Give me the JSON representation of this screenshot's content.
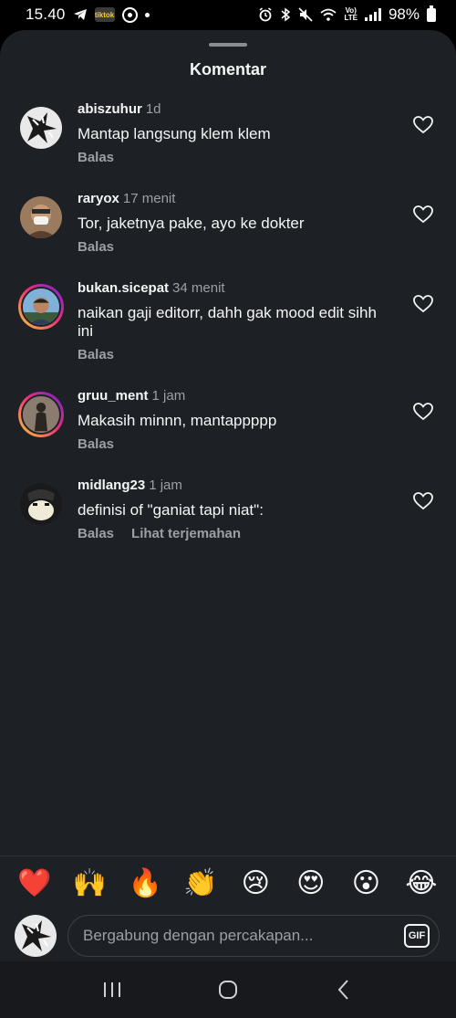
{
  "status_bar": {
    "time": "15.40",
    "battery": "98%",
    "volte_top": "Vo)",
    "volte_bottom": "LTE",
    "app_badge": "tiktok"
  },
  "sheet": {
    "title": "Komentar"
  },
  "comments": [
    {
      "username": "abiszuhur",
      "time": "1d",
      "text": "Mantap langsung klem klem",
      "reply_label": "Balas",
      "avatar_icon": "abstract-art-avatar"
    },
    {
      "username": "raryox",
      "time": "17 menit",
      "text": "Tor, jaketnya pake, ayo ke dokter",
      "reply_label": "Balas",
      "avatar_icon": "person-with-mask-avatar"
    },
    {
      "username": "bukan.sicepat",
      "time": "34 menit",
      "text": "naikan gaji editorr, dahh gak mood edit sihh ini",
      "reply_label": "Balas",
      "avatar_icon": "person-outdoor-avatar"
    },
    {
      "username": "gruu_ment",
      "time": "1 jam",
      "text": "Makasih minnn, mantappppp",
      "reply_label": "Balas",
      "avatar_icon": "silhouette-avatar"
    },
    {
      "username": "midlang23",
      "time": "1 jam",
      "text": "definisi of \"ganiat tapi niat\":",
      "reply_label": "Balas",
      "translate_label": "Lihat terjemahan",
      "avatar_icon": "dark-figure-avatar"
    }
  ],
  "emoji_reactions": [
    "❤️",
    "🙌",
    "🔥",
    "👏",
    "😢",
    "😍",
    "😮",
    "😂"
  ],
  "composer": {
    "placeholder": "Bergabung dengan percakapan...",
    "gif_label": "GIF"
  },
  "colors": {
    "background": "#1d2125",
    "text": "#f5f5f5",
    "muted": "#9aa0a6",
    "heart_emoji": "#e0245e"
  }
}
